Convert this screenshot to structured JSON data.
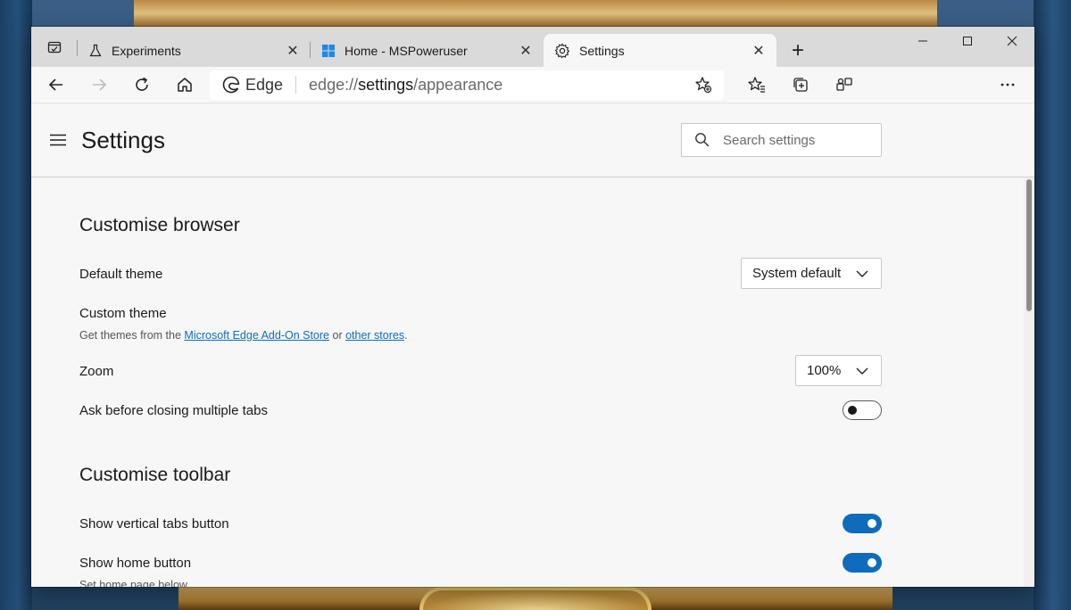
{
  "tabs": [
    {
      "title": "Experiments",
      "icon": "flask-icon",
      "close": "✕"
    },
    {
      "title": "Home - MSPoweruser",
      "icon": "windows-logo-icon",
      "close": "✕"
    },
    {
      "title": "Settings",
      "icon": "gear-icon",
      "close": "✕",
      "active": true
    }
  ],
  "new_tab": "+",
  "window_controls": {
    "minimize": "—",
    "maximize": "☐",
    "close": "✕"
  },
  "address_bar": {
    "site_name": "Edge",
    "url_scheme": "edge://",
    "url_host": "settings",
    "url_path": "/appearance"
  },
  "settings": {
    "title": "Settings",
    "search_placeholder": "Search settings"
  },
  "customise_browser": {
    "heading": "Customise browser",
    "default_theme_label": "Default theme",
    "default_theme_value": "System default",
    "custom_theme_label": "Custom theme",
    "custom_theme_desc_prefix": "Get themes from the ",
    "custom_theme_link1": "Microsoft Edge Add-On Store",
    "custom_theme_desc_mid": " or ",
    "custom_theme_link2": "other stores",
    "custom_theme_desc_suffix": ".",
    "zoom_label": "Zoom",
    "zoom_value": "100%",
    "ask_close_label": "Ask before closing multiple tabs",
    "ask_close_on": false
  },
  "customise_toolbar": {
    "heading": "Customise toolbar",
    "vertical_tabs_label": "Show vertical tabs button",
    "vertical_tabs_on": true,
    "home_button_label": "Show home button",
    "home_button_on": true,
    "home_button_desc": "Set home page below"
  },
  "colors": {
    "accent": "#0f6cbd",
    "tabstrip": "#dadada",
    "page_bg": "#f7f7f7"
  }
}
